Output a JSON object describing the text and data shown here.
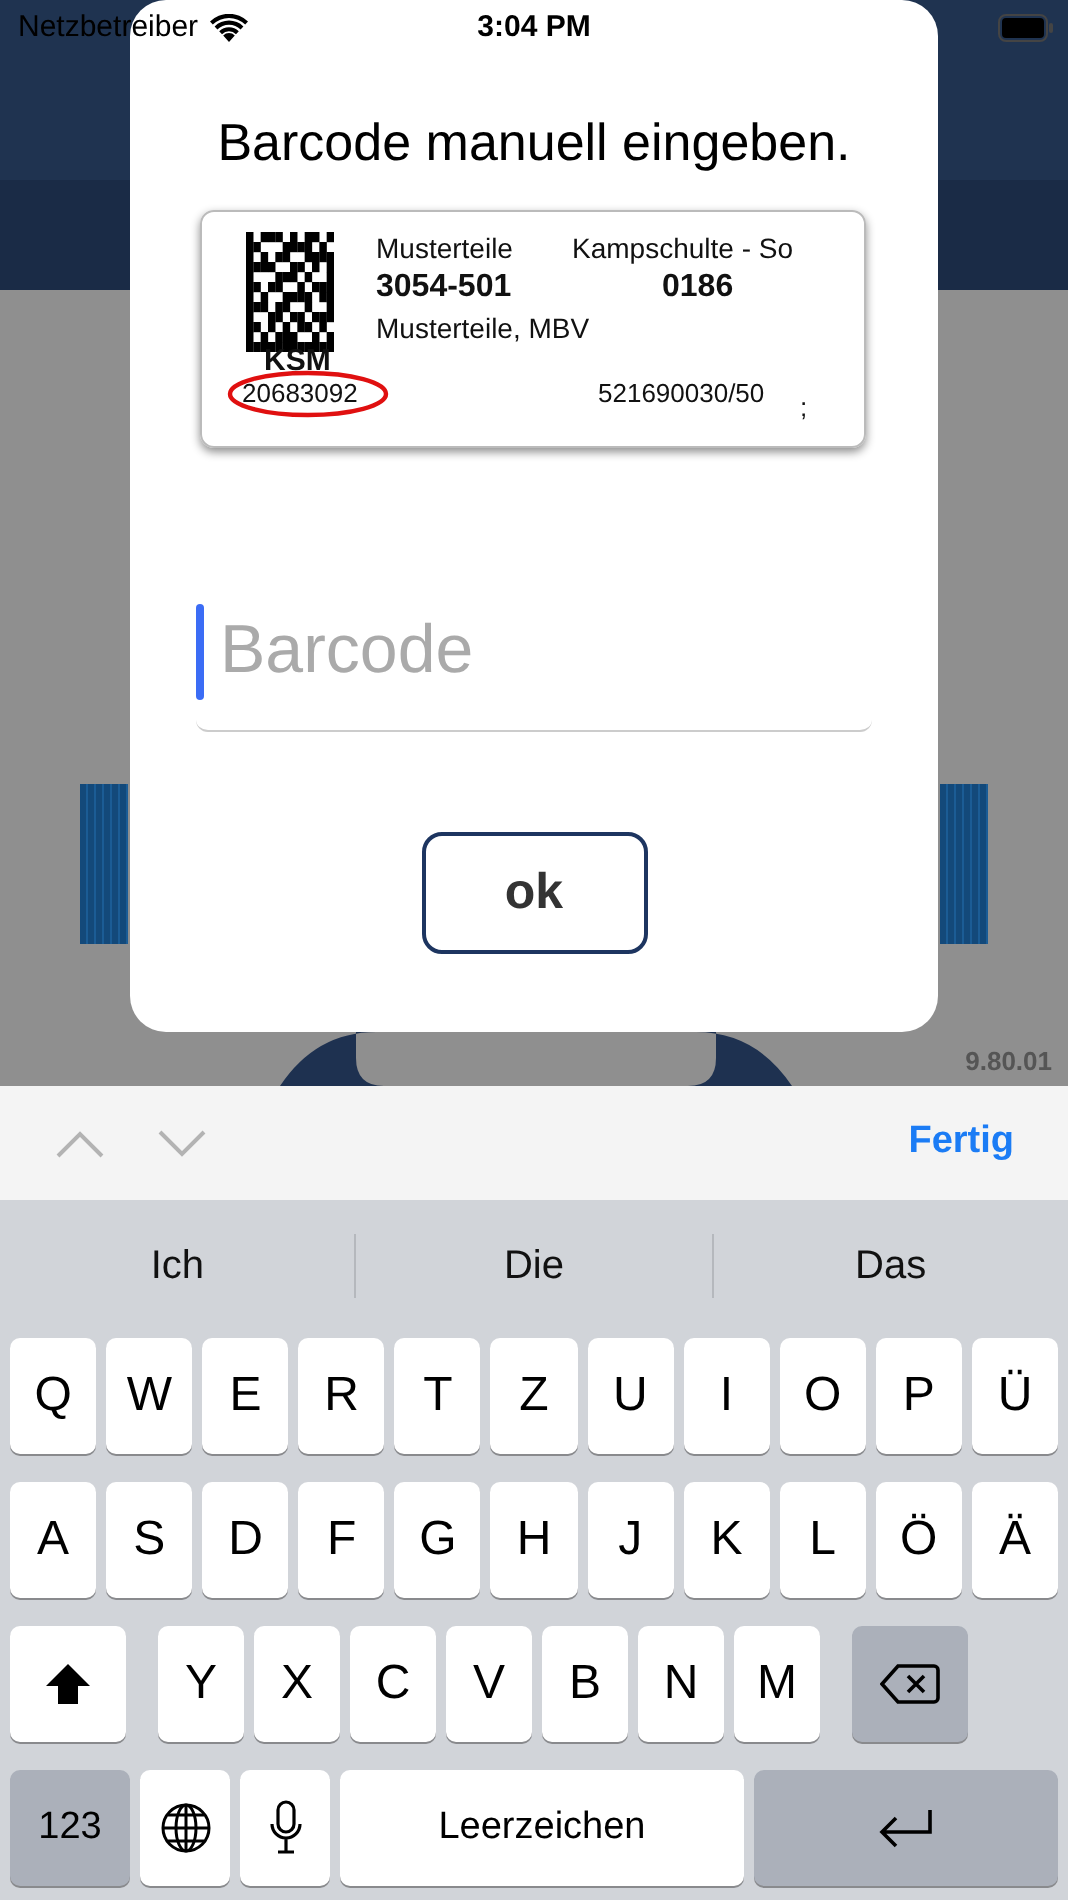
{
  "status_bar": {
    "carrier": "Netzbetreiber",
    "time": "3:04 PM"
  },
  "background": {
    "version": "9.80.01"
  },
  "dialog": {
    "title": "Barcode manuell eingeben.",
    "label": {
      "line_1_left": "Musterteile",
      "line_1_right": "Kampschulte - So",
      "part_number": "3054-501",
      "right_number": "0186",
      "description": "Musterteile, MBV",
      "code": "KSM",
      "barcode": "20683092",
      "order": "521690030/50",
      "mark": ";"
    },
    "field": {
      "placeholder": "Barcode",
      "focused": true
    },
    "button": "ok"
  },
  "keyboard": {
    "done": "Fertig",
    "suggestions": [
      "Ich",
      "Die",
      "Das"
    ],
    "rows": [
      [
        "Q",
        "W",
        "E",
        "R",
        "T",
        "Z",
        "U",
        "I",
        "O",
        "P",
        "Ü"
      ],
      [
        "A",
        "S",
        "D",
        "F",
        "G",
        "H",
        "J",
        "K",
        "L",
        "Ö",
        "Ä"
      ],
      [
        "Y",
        "X",
        "C",
        "V",
        "B",
        "N",
        "M"
      ]
    ],
    "numbers_key": "123",
    "space_key": "Leerzeichen"
  }
}
